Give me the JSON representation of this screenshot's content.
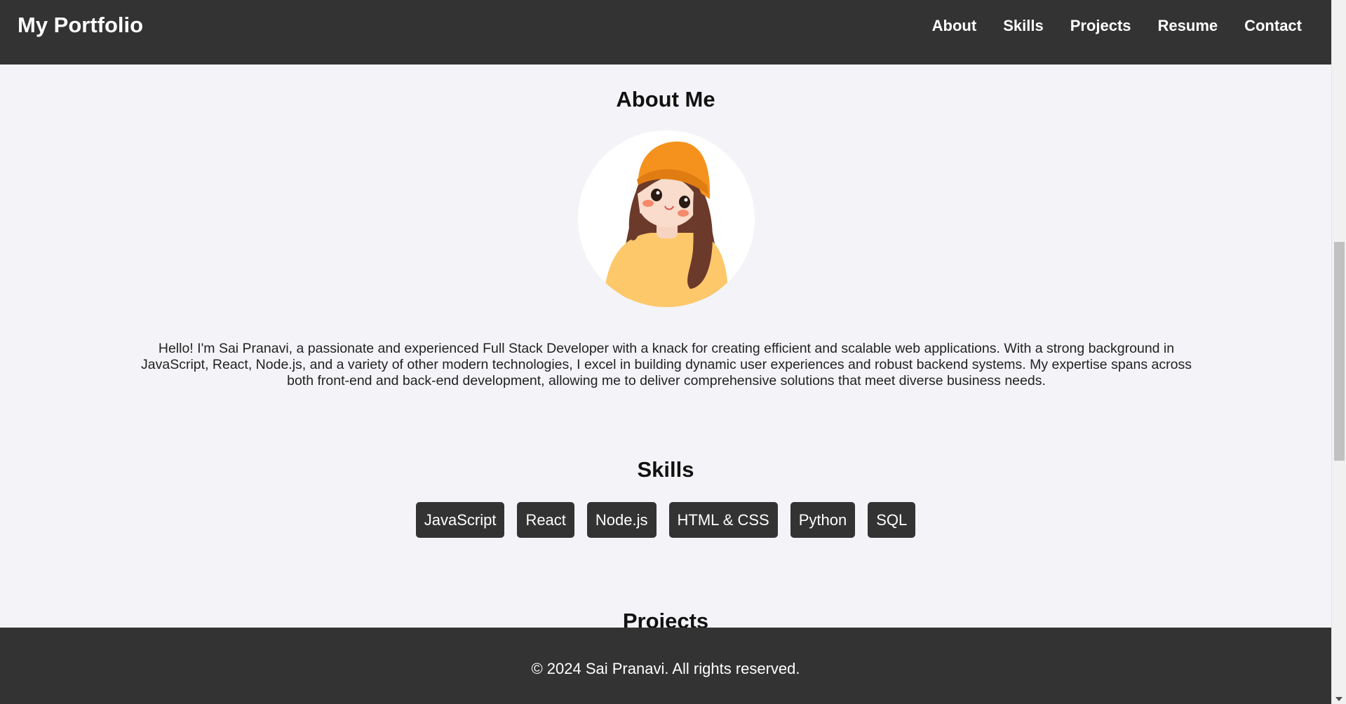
{
  "header": {
    "brand": "My Portfolio",
    "nav": [
      "About",
      "Skills",
      "Projects",
      "Resume",
      "Contact"
    ]
  },
  "about": {
    "title": "About Me",
    "avatar_icon": "cartoon-girl-avatar",
    "text": "Hello! I'm Sai Pranavi, a passionate and experienced Full Stack Developer with a knack for creating efficient and scalable web applications. With a strong background in JavaScript, React, Node.js, and a variety of other modern technologies, I excel in building dynamic user experiences and robust backend systems. My expertise spans across both front-end and back-end development, allowing me to deliver comprehensive solutions that meet diverse business needs."
  },
  "skills": {
    "title": "Skills",
    "items": [
      "JavaScript",
      "React",
      "Node.js",
      "HTML & CSS",
      "Python",
      "SQL"
    ]
  },
  "projects": {
    "title": "Projects"
  },
  "footer": {
    "text": "© 2024 Sai Pranavi. All rights reserved."
  },
  "colors": {
    "header_bg": "#333333",
    "page_bg": "#f4f4f8",
    "hat": "#f5921e",
    "hair": "#6b3a2a",
    "shirt": "#fdc86a"
  }
}
